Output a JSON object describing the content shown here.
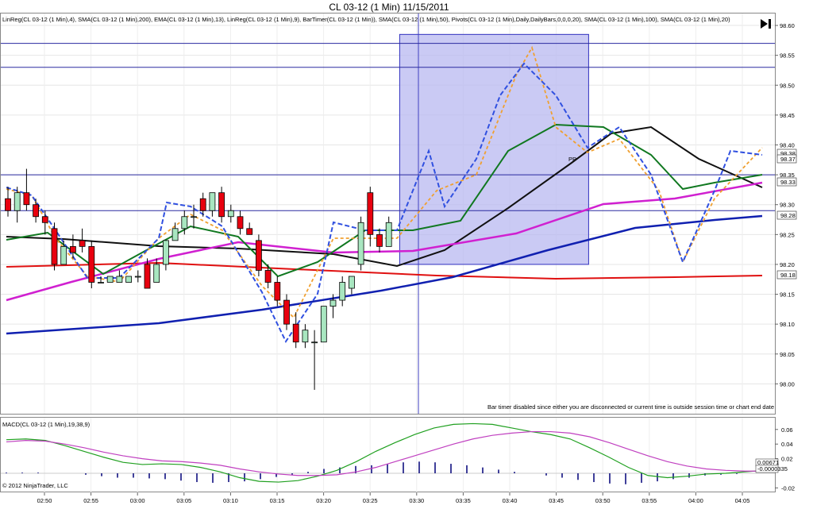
{
  "title": "CL 03-12 (1 Min)  11/15/2011",
  "indicators_line": "LinReg(CL 03-12 (1 Min),4), SMA(CL 03-12 (1 Min),200), EMA(CL 03-12 (1 Min),13), LinReg(CL 03-12 (1 Min),9), BarTimer(CL 03-12 (1 Min)), SMA(CL 03-12 (1 Min),50), Pivots(CL 03-12 (1 Min),Daily,DailyBars,0,0,0,20), SMA(CL 03-12 (1 Min),100), SMA(CL 03-12 (1 Min),20)",
  "bar_timer_message": "Bar timer disabled since either you are disconnected or current time is outside session time or chart end date",
  "pivot_label": "PP",
  "macd_label": "MACD(CL 03-12 (1 Min),19,38,9)",
  "copyright": "© 2012 NinjaTrader, LLC",
  "play_icon": "skip-to-end-icon",
  "colors": {
    "up_candle": "#a8e6c0",
    "down_candle": "#e8000f",
    "sma200": "#e01010",
    "sma100": "#1020b0",
    "sma50": "#101010",
    "sma20": "#d020d0",
    "ema13": "#107820",
    "linreg4": "#3050e0",
    "linreg9": "#f0a030",
    "highlight": "#b8b8f0",
    "macd": "#20a020",
    "macd_avg": "#c040c0",
    "macd_diff": "#101080"
  },
  "chart_data": [
    {
      "type": "candlestick",
      "title": "CL 03-12 (1 Min)  11/15/2011",
      "x": [
        "02:50",
        "02:55",
        "03:00",
        "03:05",
        "03:10",
        "03:15",
        "03:20",
        "03:25",
        "03:30",
        "03:35",
        "03:40",
        "03:45",
        "03:50",
        "03:55",
        "04:00",
        "04:05"
      ],
      "ylim": [
        97.95,
        98.62
      ],
      "y_ticks": [
        "98.60",
        "98.55",
        "98.50",
        "98.45",
        "98.40",
        "98.35",
        "98.30",
        "98.25",
        "98.20",
        "98.15",
        "98.10",
        "98.05",
        "98.00"
      ],
      "price_markers": [
        "98.38",
        "98.37",
        "98.33",
        "98.28",
        "98.18"
      ],
      "horizontal_lines": [
        98.57,
        98.53,
        98.35,
        98.29
      ],
      "highlight_region": {
        "start_bar": 42,
        "end_bar": 62,
        "low": 98.2,
        "high": 98.585
      },
      "vertical_line_bar": 44,
      "candles": [
        [
          98.31,
          98.33,
          98.28,
          98.29
        ],
        [
          98.29,
          98.33,
          98.27,
          98.32
        ],
        [
          98.32,
          98.36,
          98.29,
          98.3
        ],
        [
          98.3,
          98.31,
          98.27,
          98.28
        ],
        [
          98.28,
          98.29,
          98.25,
          98.27
        ],
        [
          98.26,
          98.27,
          98.19,
          98.2
        ],
        [
          98.2,
          98.24,
          98.2,
          98.23
        ],
        [
          98.23,
          98.25,
          98.21,
          98.22
        ],
        [
          98.24,
          98.26,
          98.22,
          98.23
        ],
        [
          98.23,
          98.24,
          98.16,
          98.17
        ],
        [
          98.17,
          98.18,
          98.17,
          98.17
        ],
        [
          98.17,
          98.18,
          98.17,
          98.18
        ],
        [
          98.17,
          98.19,
          98.17,
          98.18
        ],
        [
          98.17,
          98.18,
          98.17,
          98.18
        ],
        [
          98.18,
          98.19,
          98.17,
          98.18
        ],
        [
          98.2,
          98.21,
          98.16,
          98.16
        ],
        [
          98.17,
          98.21,
          98.17,
          98.2
        ],
        [
          98.2,
          98.24,
          98.19,
          98.24
        ],
        [
          98.24,
          98.27,
          98.24,
          98.26
        ],
        [
          98.26,
          98.29,
          98.25,
          98.28
        ],
        [
          98.28,
          98.3,
          98.26,
          98.28
        ],
        [
          98.31,
          98.32,
          98.28,
          98.29
        ],
        [
          98.29,
          98.32,
          98.28,
          98.32
        ],
        [
          98.32,
          98.33,
          98.27,
          98.28
        ],
        [
          98.28,
          98.3,
          98.27,
          98.29
        ],
        [
          98.28,
          98.29,
          98.25,
          98.26
        ],
        [
          98.26,
          98.27,
          98.25,
          98.25
        ],
        [
          98.24,
          98.25,
          98.18,
          98.19
        ],
        [
          98.19,
          98.2,
          98.16,
          98.17
        ],
        [
          98.17,
          98.18,
          98.13,
          98.14
        ],
        [
          98.14,
          98.15,
          98.09,
          98.1
        ],
        [
          98.1,
          98.12,
          98.06,
          98.07
        ],
        [
          98.07,
          98.1,
          98.06,
          98.09
        ],
        [
          98.07,
          98.09,
          97.99,
          98.07
        ],
        [
          98.07,
          98.13,
          98.07,
          98.13
        ],
        [
          98.13,
          98.15,
          98.11,
          98.14
        ],
        [
          98.14,
          98.18,
          98.13,
          98.17
        ],
        [
          98.16,
          98.18,
          98.15,
          98.18
        ],
        [
          98.2,
          98.28,
          98.19,
          98.27
        ],
        [
          98.32,
          98.33,
          98.23,
          98.25
        ],
        [
          98.25,
          98.26,
          98.22,
          98.23
        ],
        [
          98.23,
          98.28,
          98.23,
          98.27
        ]
      ]
    },
    {
      "type": "line",
      "title": "MACD(CL 03-12 (1 Min),19,38,9)",
      "ylim": [
        -0.025,
        0.075
      ],
      "y_ticks": [
        "0.06",
        "0.04",
        "0.02",
        "-0.02"
      ],
      "markers": [
        "0.00671",
        "-0.0000335"
      ],
      "series": [
        {
          "values": [
            0.046,
            0.047,
            0.045,
            0.038,
            0.03,
            0.022,
            0.015,
            0.012,
            0.013,
            0.012,
            0.008,
            0.002,
            -0.006,
            -0.011,
            -0.012,
            -0.01,
            -0.004,
            0.004,
            0.016,
            0.03,
            0.042,
            0.053,
            0.062,
            0.067,
            0.068,
            0.067,
            0.062,
            0.057,
            0.053,
            0.047,
            0.035,
            0.022,
            0.008,
            -0.003,
            -0.006,
            -0.004,
            -0.001,
            0.0,
            0.002,
            0.004
          ]
        },
        {
          "values": [
            0.043,
            0.045,
            0.044,
            0.04,
            0.035,
            0.029,
            0.024,
            0.02,
            0.017,
            0.016,
            0.014,
            0.011,
            0.006,
            0.002,
            -0.001,
            -0.003,
            -0.003,
            -0.002,
            0.002,
            0.008,
            0.016,
            0.024,
            0.032,
            0.04,
            0.047,
            0.052,
            0.055,
            0.057,
            0.057,
            0.055,
            0.05,
            0.042,
            0.033,
            0.024,
            0.016,
            0.01,
            0.006,
            0.004,
            0.003,
            0.003
          ]
        }
      ],
      "histogram": [
        0.001,
        0.001,
        0.001,
        0,
        0,
        -0.002,
        -0.004,
        -0.006,
        -0.006,
        -0.007,
        -0.008,
        -0.01,
        -0.012,
        -0.013,
        -0.012,
        -0.011,
        -0.008,
        -0.005,
        -0.002,
        0.002,
        0.006,
        0.008,
        0.01,
        0.011,
        0.013,
        0.015,
        0.016,
        0.015,
        0.013,
        0.011,
        0.008,
        0.005,
        0.002,
        0,
        -0.003,
        -0.006,
        -0.009,
        -0.012,
        -0.014,
        -0.015,
        -0.013,
        -0.011,
        -0.008,
        -0.006,
        -0.003,
        -0.002,
        -0.001,
        0
      ]
    }
  ]
}
